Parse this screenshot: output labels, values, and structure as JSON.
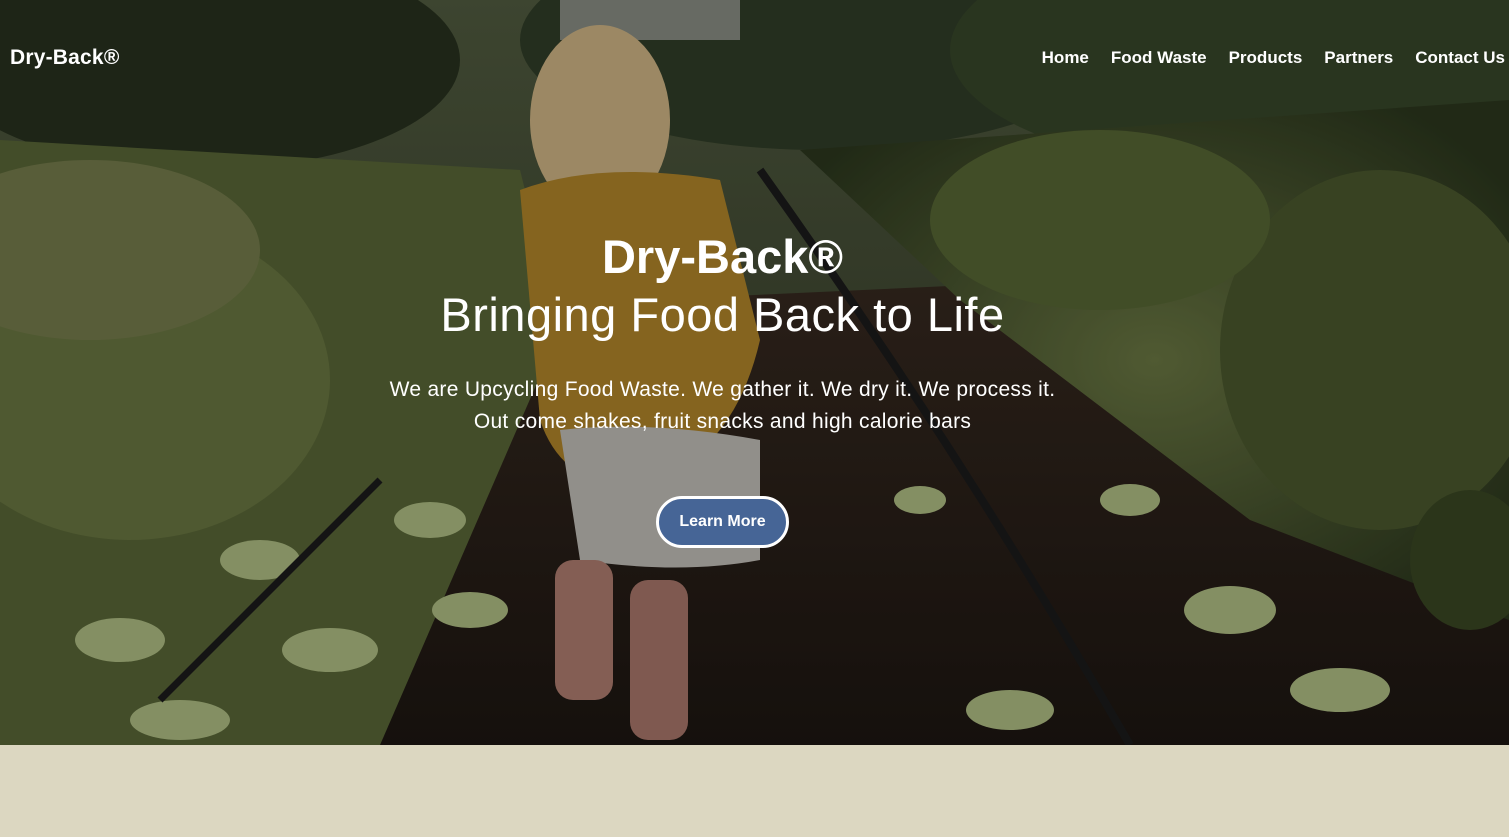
{
  "nav": {
    "brand": "Dry-Back®",
    "links": [
      "Home",
      "Food Waste",
      "Products",
      "Partners",
      "Contact Us"
    ]
  },
  "hero": {
    "title": "Dry-Back®",
    "subtitle": "Bringing Food Back to Life",
    "description_line1": "We are Upcycling Food Waste. We gather it. We dry it. We process it.",
    "description_line2": "Out come shakes, fruit snacks and high calorie bars",
    "cta_label": "Learn More",
    "background": "photo of a child in a yellow sweater walking between garden beds of kale and seedlings"
  },
  "colors": {
    "button_bg": "#466596",
    "band_bg": "#dcd7c1",
    "text": "#ffffff"
  }
}
